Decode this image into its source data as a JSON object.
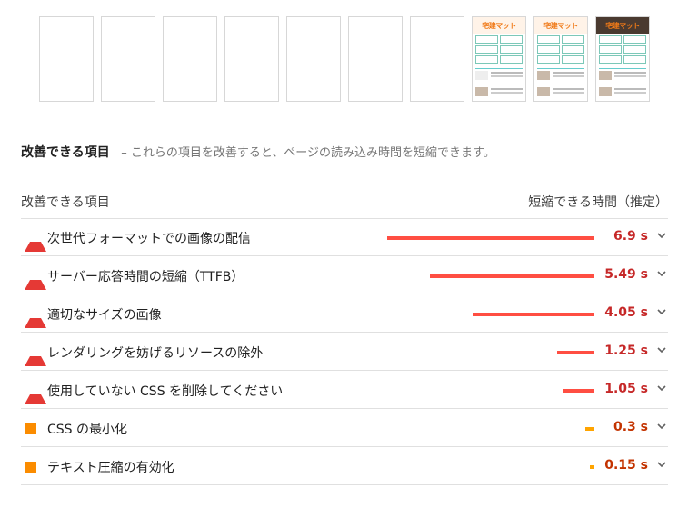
{
  "filmstrip": {
    "frames": [
      {
        "loaded": false
      },
      {
        "loaded": false
      },
      {
        "loaded": false
      },
      {
        "loaded": false
      },
      {
        "loaded": false
      },
      {
        "loaded": false
      },
      {
        "loaded": false
      },
      {
        "loaded": true,
        "dark": false,
        "title": "宅建マット"
      },
      {
        "loaded": true,
        "dark": false,
        "title": "宅建マット"
      },
      {
        "loaded": true,
        "dark": true,
        "title": "宅建マット"
      }
    ]
  },
  "section": {
    "title": "改善できる項目",
    "description": "– これらの項目を改善すると、ページの読み込み時間を短縮できます。"
  },
  "table": {
    "col_left": "改善できる項目",
    "col_right": "短縮できる時間（推定）",
    "bar_max_value": 6.9,
    "colors": {
      "fail": "#ff4e42",
      "average": "#ffa400",
      "fail_text": "#c62828",
      "average_text": "#c33300"
    },
    "rows": [
      {
        "label": "次世代フォーマットでの画像の配信",
        "value": "6.9 s",
        "seconds": 6.9,
        "severity": "fail",
        "icon": "triangle-warning-icon"
      },
      {
        "label": "サーバー応答時間の短縮（TTFB）",
        "value": "5.49 s",
        "seconds": 5.49,
        "severity": "fail",
        "icon": "triangle-warning-icon"
      },
      {
        "label": "適切なサイズの画像",
        "value": "4.05 s",
        "seconds": 4.05,
        "severity": "fail",
        "icon": "triangle-warning-icon"
      },
      {
        "label": "レンダリングを妨げるリソースの除外",
        "value": "1.25 s",
        "seconds": 1.25,
        "severity": "fail",
        "icon": "triangle-warning-icon"
      },
      {
        "label": "使用していない CSS を削除してください",
        "value": "1.05 s",
        "seconds": 1.05,
        "severity": "fail",
        "icon": "triangle-warning-icon"
      },
      {
        "label": "CSS の最小化",
        "value": "0.3 s",
        "seconds": 0.3,
        "severity": "average",
        "icon": "square-info-icon"
      },
      {
        "label": "テキスト圧縮の有効化",
        "value": "0.15 s",
        "seconds": 0.15,
        "severity": "average",
        "icon": "square-info-icon"
      }
    ]
  }
}
